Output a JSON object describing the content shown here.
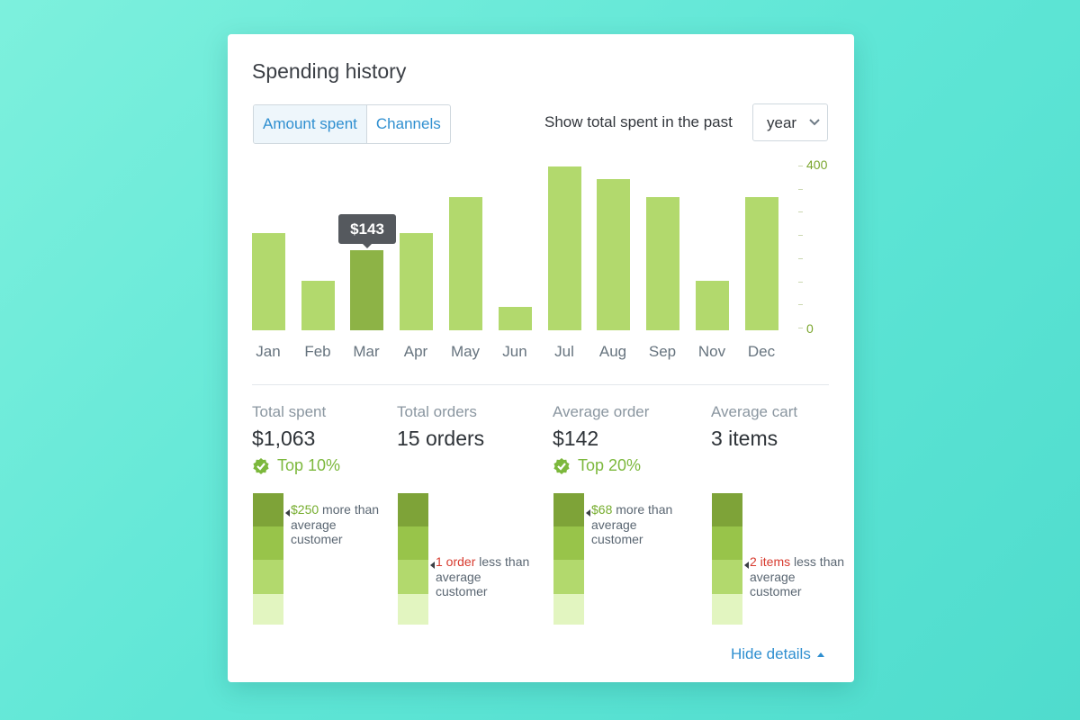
{
  "card": {
    "title": "Spending history",
    "tabs": [
      {
        "label": "Amount spent",
        "active": true
      },
      {
        "label": "Channels",
        "active": false
      }
    ],
    "range_label": "Show total spent in the past",
    "range_value": "year"
  },
  "chart_data": {
    "type": "bar",
    "categories": [
      "Jan",
      "Feb",
      "Mar",
      "Apr",
      "May",
      "Jun",
      "Jul",
      "Aug",
      "Sep",
      "Nov",
      "Dec"
    ],
    "values": [
      238,
      120,
      196,
      238,
      326,
      58,
      400,
      370,
      326,
      120,
      326
    ],
    "ylim": [
      0,
      400
    ],
    "ytick_labels": [
      "400",
      "0"
    ],
    "highlighted_index": 2,
    "tooltip": "$143",
    "colors": {
      "bar": "#b2d96d",
      "highlight": "#8db346"
    }
  },
  "stats": [
    {
      "label": "Total spent",
      "value": "$1,063",
      "badge": "Top 10%",
      "level": 0,
      "note_highlight": "$250",
      "note_rest": " more than average customer",
      "note_tone": "positive"
    },
    {
      "label": "Total orders",
      "value": "15 orders",
      "badge": "",
      "level": 2,
      "note_highlight": "1 order",
      "note_rest": " less than average customer",
      "note_tone": "negative"
    },
    {
      "label": "Average order",
      "value": "$142",
      "badge": "Top 20%",
      "level": 0,
      "note_highlight": "$68",
      "note_rest": " more than average customer",
      "note_tone": "positive"
    },
    {
      "label": "Average cart",
      "value": "3 items",
      "badge": "",
      "level": 2,
      "note_highlight": "2 items",
      "note_rest": " less than average customer",
      "note_tone": "negative"
    }
  ],
  "footer": {
    "hide_details": "Hide details"
  },
  "icons": {
    "badge": "check-badge-icon",
    "select": "chevron-down-icon",
    "hide": "caret-up-icon"
  }
}
